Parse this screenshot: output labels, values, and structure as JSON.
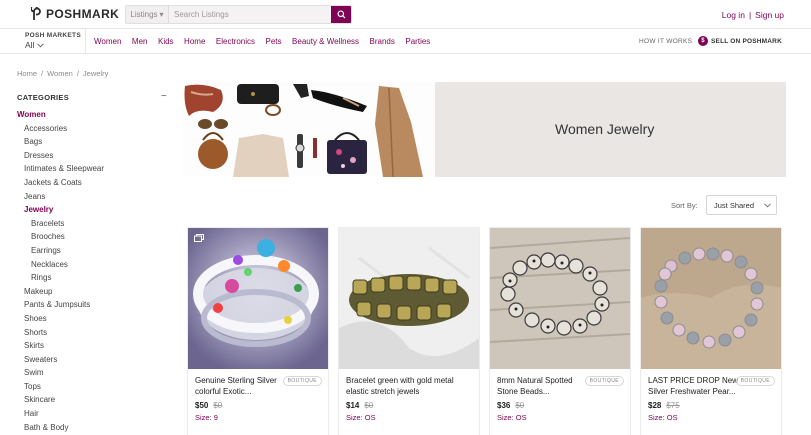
{
  "header": {
    "logo_text": "POSHMARK",
    "search": {
      "category": "Listings",
      "placeholder": "Search Listings"
    },
    "login": "Log in",
    "signup": "Sign up"
  },
  "nav": {
    "posh_markets_label": "POSH MARKETS",
    "posh_markets_value": "All",
    "links": [
      "Women",
      "Men",
      "Kids",
      "Home",
      "Electronics",
      "Pets",
      "Beauty & Wellness",
      "Brands",
      "Parties"
    ],
    "how_it_works": "HOW IT WORKS",
    "sell_label": "SELL ON POSHMARK",
    "sell_icon_text": "$"
  },
  "breadcrumb": [
    "Home",
    "/",
    "Women",
    "/",
    "Jewelry"
  ],
  "sidebar": {
    "heading": "CATEGORIES",
    "collapse_symbol": "−",
    "items": [
      {
        "label": "Women",
        "level": 0,
        "active": true
      },
      {
        "label": "Accessories",
        "level": 1
      },
      {
        "label": "Bags",
        "level": 1
      },
      {
        "label": "Dresses",
        "level": 1
      },
      {
        "label": "Intimates & Sleepwear",
        "level": 1
      },
      {
        "label": "Jackets & Coats",
        "level": 1
      },
      {
        "label": "Jeans",
        "level": 1
      },
      {
        "label": "Jewelry",
        "level": 1,
        "active": true
      },
      {
        "label": "Bracelets",
        "level": 2
      },
      {
        "label": "Brooches",
        "level": 2
      },
      {
        "label": "Earrings",
        "level": 2
      },
      {
        "label": "Necklaces",
        "level": 2
      },
      {
        "label": "Rings",
        "level": 2
      },
      {
        "label": "Makeup",
        "level": 1
      },
      {
        "label": "Pants & Jumpsuits",
        "level": 1
      },
      {
        "label": "Shoes",
        "level": 1
      },
      {
        "label": "Shorts",
        "level": 1
      },
      {
        "label": "Skirts",
        "level": 1
      },
      {
        "label": "Sweaters",
        "level": 1
      },
      {
        "label": "Swim",
        "level": 1
      },
      {
        "label": "Tops",
        "level": 1
      },
      {
        "label": "Skincare",
        "level": 1
      },
      {
        "label": "Hair",
        "level": 1
      },
      {
        "label": "Bath & Body",
        "level": 1
      }
    ]
  },
  "banner": {
    "title": "Women Jewelry"
  },
  "sort": {
    "label": "Sort By:",
    "value": "Just Shared"
  },
  "listings": [
    {
      "title": "Genuine Sterling Silver colorful Exotic...",
      "price": "$50",
      "original_price": "$0",
      "size": "Size: 9",
      "boutique": "BOUTIQUE",
      "icon": "multi-image-icon"
    },
    {
      "title": "Bracelet green with gold metal elastic stretch jewels",
      "price": "$14",
      "original_price": "$0",
      "size": "Size: OS",
      "boutique": ""
    },
    {
      "title": "8mm Natural Spotted Stone Beads...",
      "price": "$36",
      "original_price": "$0",
      "size": "Size: OS",
      "boutique": "BOUTIQUE"
    },
    {
      "title": "LAST PRICE DROP New Silver Freshwater Pear...",
      "price": "$28",
      "original_price": "$75",
      "size": "Size: OS",
      "boutique": "BOUTIQUE"
    }
  ],
  "colors": {
    "brand": "#7f0353",
    "banner_bg": "#e9e6e4"
  }
}
